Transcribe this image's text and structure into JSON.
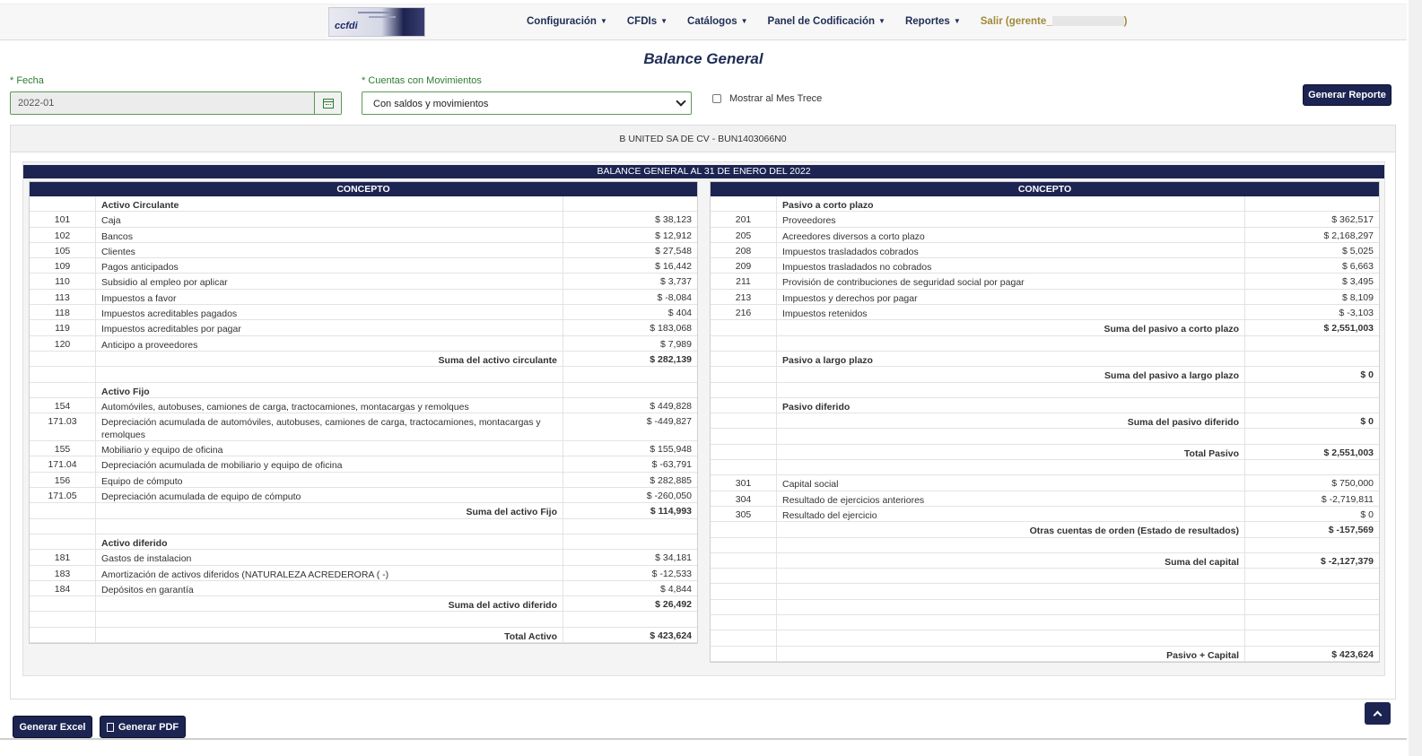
{
  "nav": {
    "items": [
      "Configuración",
      "CFDIs",
      "Catálogos",
      "Panel de Codificación",
      "Reportes"
    ],
    "exit_prefix": "Salir (gerente_",
    "exit_suffix": ")",
    "logo_text": "ccfdi"
  },
  "page": {
    "title": "Balance General"
  },
  "form": {
    "fecha_label": "* Fecha",
    "fecha_value": "2022-01",
    "cuentas_label": "* Cuentas con Movimientos",
    "cuentas_value": "Con saldos y movimientos",
    "mes_trece_label": "Mostrar al Mes Trece",
    "generate_label": "Generar Reporte"
  },
  "report": {
    "company": "B UNITED SA DE CV - BUN1403066N0",
    "heading": "BALANCE GENERAL AL 31 DE ENERO DEL 2022",
    "concept_header": "CONCEPTO",
    "left": [
      {
        "code": "",
        "name": "Activo Circulante",
        "amount": "",
        "style": "section"
      },
      {
        "code": "101",
        "name": "Caja",
        "amount": "$ 38,123"
      },
      {
        "code": "102",
        "name": "Bancos",
        "amount": "$ 12,912"
      },
      {
        "code": "105",
        "name": "Clientes",
        "amount": "$ 27,548"
      },
      {
        "code": "109",
        "name": "Pagos anticipados",
        "amount": "$ 16,442"
      },
      {
        "code": "110",
        "name": "Subsidio al empleo por aplicar",
        "amount": "$ 3,737"
      },
      {
        "code": "113",
        "name": "Impuestos a favor",
        "amount": "$ -8,084"
      },
      {
        "code": "118",
        "name": "Impuestos acreditables pagados",
        "amount": "$ 404"
      },
      {
        "code": "119",
        "name": "Impuestos acreditables por pagar",
        "amount": "$ 183,068"
      },
      {
        "code": "120",
        "name": "Anticipo a proveedores",
        "amount": "$ 7,989"
      },
      {
        "code": "",
        "name": "Suma del activo circulante",
        "amount": "$ 282,139",
        "style": "total"
      },
      {
        "code": "",
        "name": "",
        "amount": ""
      },
      {
        "code": "",
        "name": "Activo Fijo",
        "amount": "",
        "style": "section"
      },
      {
        "code": "154",
        "name": "Automóviles, autobuses, camiones de carga, tractocamiones, montacargas y remolques",
        "amount": "$ 449,828"
      },
      {
        "code": "171.03",
        "name": "Depreciación acumulada de automóviles, autobuses, camiones de carga, tractocamiones, montacargas y remolques",
        "amount": "$ -449,827",
        "style": "tall"
      },
      {
        "code": "155",
        "name": "Mobiliario y equipo de oficina",
        "amount": "$ 155,948"
      },
      {
        "code": "171.04",
        "name": "Depreciación acumulada de mobiliario y equipo de oficina",
        "amount": "$ -63,791"
      },
      {
        "code": "156",
        "name": "Equipo de cómputo",
        "amount": "$ 282,885"
      },
      {
        "code": "171.05",
        "name": "Depreciación acumulada de equipo de cómputo",
        "amount": "$ -260,050"
      },
      {
        "code": "",
        "name": "Suma del activo Fijo",
        "amount": "$ 114,993",
        "style": "total"
      },
      {
        "code": "",
        "name": "",
        "amount": ""
      },
      {
        "code": "",
        "name": "Activo diferido",
        "amount": "",
        "style": "section"
      },
      {
        "code": "181",
        "name": "Gastos de instalacion",
        "amount": "$ 34,181"
      },
      {
        "code": "183",
        "name": "Amortización de activos diferidos (NATURALEZA ACREDERORA ( -)",
        "amount": "$ -12,533"
      },
      {
        "code": "184",
        "name": "Depósitos en garantía",
        "amount": "$ 4,844"
      },
      {
        "code": "",
        "name": "Suma del activo diferido",
        "amount": "$ 26,492",
        "style": "total"
      },
      {
        "code": "",
        "name": "",
        "amount": ""
      },
      {
        "code": "",
        "name": "Total Activo",
        "amount": "$ 423,624",
        "style": "total"
      }
    ],
    "right": [
      {
        "code": "",
        "name": "Pasivo a corto plazo",
        "amount": "",
        "style": "section"
      },
      {
        "code": "201",
        "name": "Proveedores",
        "amount": "$ 362,517"
      },
      {
        "code": "205",
        "name": "Acreedores diversos a corto plazo",
        "amount": "$ 2,168,297"
      },
      {
        "code": "208",
        "name": "Impuestos trasladados cobrados",
        "amount": "$ 5,025"
      },
      {
        "code": "209",
        "name": "Impuestos trasladados no cobrados",
        "amount": "$ 6,663"
      },
      {
        "code": "211",
        "name": "Provisión de contribuciones de seguridad social por pagar",
        "amount": "$ 3,495"
      },
      {
        "code": "213",
        "name": "Impuestos y derechos por pagar",
        "amount": "$ 8,109"
      },
      {
        "code": "216",
        "name": "Impuestos retenidos",
        "amount": "$ -3,103"
      },
      {
        "code": "",
        "name": "Suma del pasivo a corto plazo",
        "amount": "$ 2,551,003",
        "style": "total"
      },
      {
        "code": "",
        "name": "",
        "amount": ""
      },
      {
        "code": "",
        "name": "Pasivo a largo plazo",
        "amount": "",
        "style": "section"
      },
      {
        "code": "",
        "name": "Suma del pasivo a largo plazo",
        "amount": "$ 0",
        "style": "total"
      },
      {
        "code": "",
        "name": "",
        "amount": ""
      },
      {
        "code": "",
        "name": "Pasivo diferido",
        "amount": "",
        "style": "section"
      },
      {
        "code": "",
        "name": "Suma del pasivo diferido",
        "amount": "$ 0",
        "style": "total"
      },
      {
        "code": "",
        "name": "",
        "amount": ""
      },
      {
        "code": "",
        "name": "Total Pasivo",
        "amount": "$ 2,551,003",
        "style": "total"
      },
      {
        "code": "",
        "name": "",
        "amount": ""
      },
      {
        "code": "301",
        "name": "Capital social",
        "amount": "$ 750,000"
      },
      {
        "code": "304",
        "name": "Resultado de ejercicios anteriores",
        "amount": "$ -2,719,811"
      },
      {
        "code": "305",
        "name": "Resultado del ejercicio",
        "amount": "$ 0"
      },
      {
        "code": "",
        "name": "Otras cuentas de orden (Estado de resultados)",
        "amount": "$ -157,569",
        "style": "total"
      },
      {
        "code": "",
        "name": "",
        "amount": ""
      },
      {
        "code": "",
        "name": "Suma del capital",
        "amount": "$ -2,127,379",
        "style": "total"
      },
      {
        "code": "",
        "name": "",
        "amount": ""
      },
      {
        "code": "",
        "name": "",
        "amount": ""
      },
      {
        "code": "",
        "name": "",
        "amount": ""
      },
      {
        "code": "",
        "name": "",
        "amount": ""
      },
      {
        "code": "",
        "name": "",
        "amount": ""
      },
      {
        "code": "",
        "name": "Pasivo + Capital",
        "amount": "$ 423,624",
        "style": "total"
      }
    ]
  },
  "footer": {
    "excel_label": "Generar Excel",
    "pdf_label": "Generar PDF"
  }
}
